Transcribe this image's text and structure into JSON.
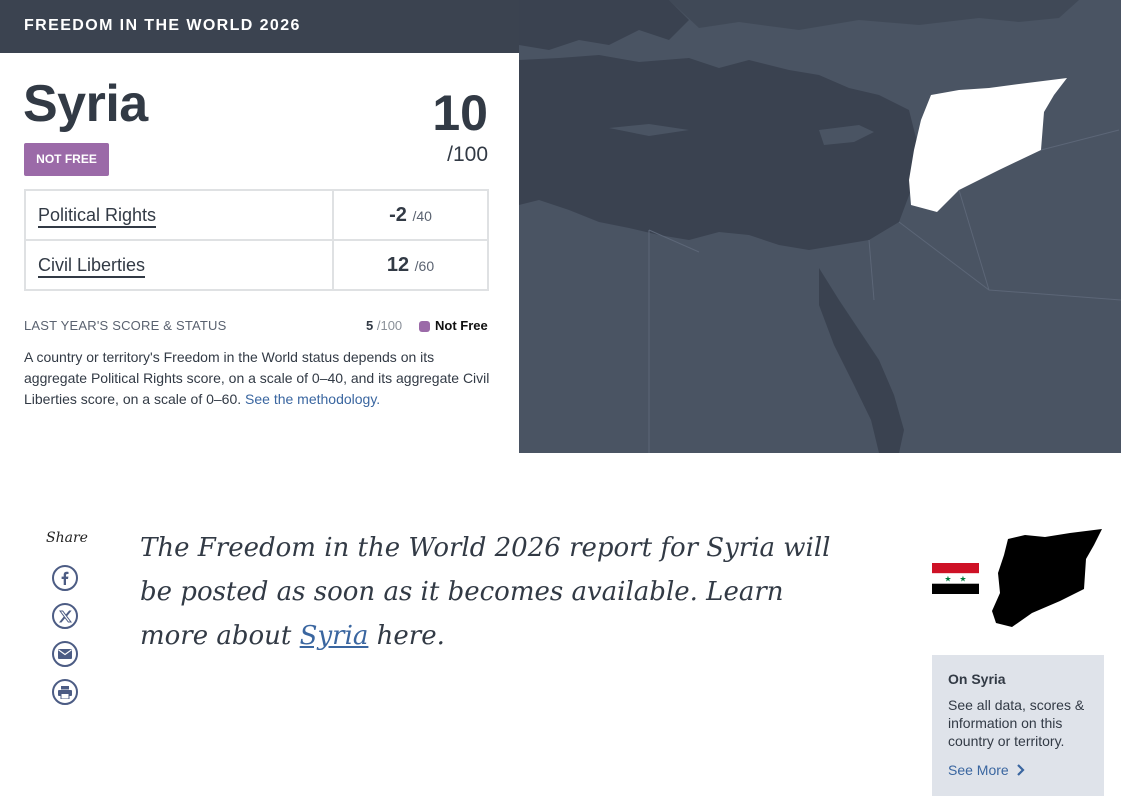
{
  "header": {
    "title": "FREEDOM IN THE WORLD 2026"
  },
  "country": {
    "name": "Syria",
    "status": "NOT FREE",
    "score": "10",
    "score_total": "/100"
  },
  "categories": [
    {
      "label": "Political Rights",
      "score": "-2",
      "max": "/40"
    },
    {
      "label": "Civil Liberties",
      "score": "12",
      "max": "/60"
    }
  ],
  "last_year": {
    "label": "LAST YEAR'S SCORE & STATUS",
    "score": "5",
    "max": "/100",
    "status": "Not Free"
  },
  "description": {
    "text": "A country or territory's Freedom in the World status depends on its aggregate Political Rights score, on a scale of 0–40, and its aggregate Civil Liberties score, on a scale of 0–60.",
    "link_text": "See the methodology."
  },
  "share": {
    "label": "Share"
  },
  "report": {
    "text_before": "The Freedom in the World 2026 report for Syria will be posted as soon as it becomes available. Learn more about",
    "link_text": "Syria",
    "text_after": "here."
  },
  "side_card": {
    "title": "On Syria",
    "text": "See all data, scores & information on this country or territory.",
    "link": "See More"
  },
  "colors": {
    "header_bg": "#3b4350",
    "not_free": "#9b6aa8",
    "map_land": "#4a5463",
    "map_sea": "#3a4250",
    "link": "#3a66a0"
  },
  "icons": [
    "facebook-icon",
    "x-icon",
    "email-icon",
    "print-icon",
    "chevron-right-icon"
  ]
}
